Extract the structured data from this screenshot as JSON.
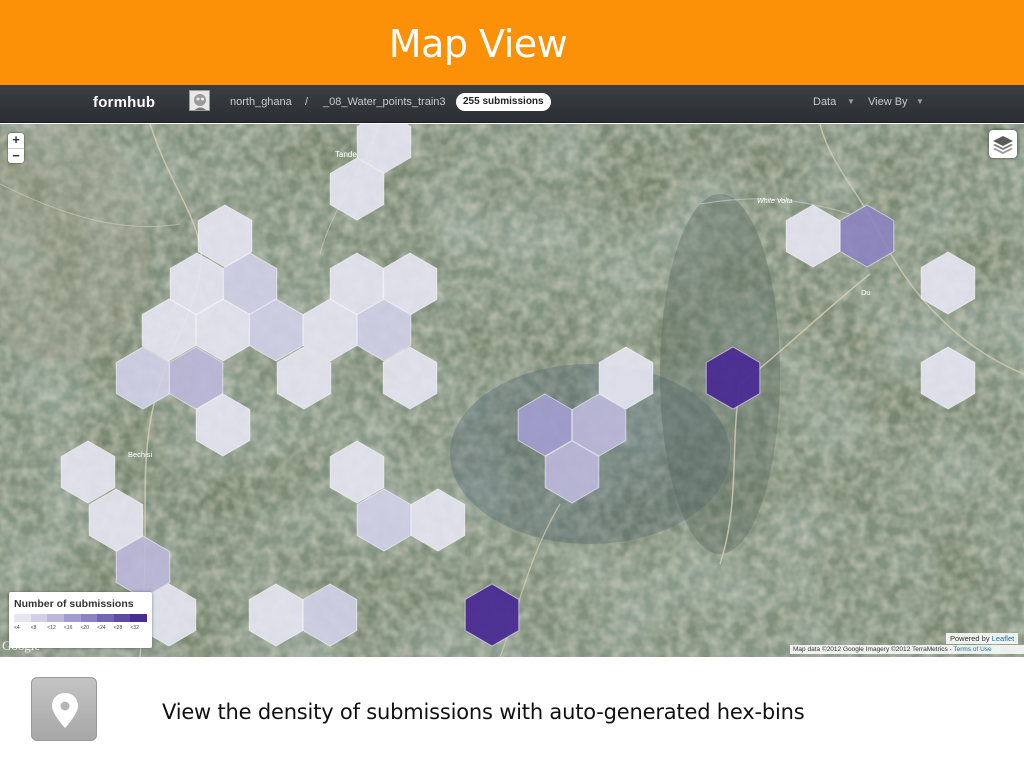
{
  "slide": {
    "title": "Map View",
    "caption": "View the density of submissions with auto-generated hex-bins",
    "banner_color": "#fc9006"
  },
  "navbar": {
    "brand": "formhub",
    "breadcrumb_user": "north_ghana",
    "breadcrumb_separator": "/",
    "breadcrumb_form": "_08_Water_points_train3",
    "submissions_badge": "255 submissions",
    "menu_data": "Data",
    "menu_view_by": "View By"
  },
  "map": {
    "zoom_in": "+",
    "zoom_out": "−",
    "labels": [
      "Tande",
      "White Volta",
      "Du",
      "Bechisi"
    ],
    "google_logo": "Google",
    "powered_by_prefix": "Powered by",
    "powered_by_link": "Leaflet",
    "attribution": "Map data ©2012 Google Imagery ©2012 TerraMetrics",
    "attribution_link": "Terms of Use",
    "icons": [
      "layers-icon",
      "map-pin-icon"
    ]
  },
  "legend": {
    "title": "Number of submissions",
    "bins": [
      "<4",
      "<8",
      "<12",
      "<16",
      "<20",
      "<24",
      "<28",
      "<32"
    ],
    "colors": [
      "#e6e5f2",
      "#d2d0e9",
      "#bcb8dc",
      "#a29dcf",
      "#8c84c2",
      "#7466b2",
      "#5e4ca3",
      "#4a2c93"
    ]
  }
}
